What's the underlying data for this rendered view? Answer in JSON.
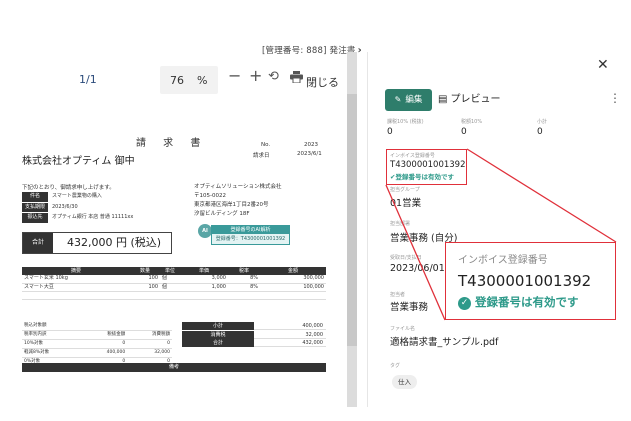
{
  "toolbar": {
    "management_number": "[管理番号: 888] 発注書",
    "page_indicator": "1/1",
    "zoom_value": "76",
    "zoom_unit": "%",
    "close_label": "閉じる"
  },
  "document": {
    "title": "請 求 書",
    "recipient": "株式会社オプティム 御中",
    "no_label": "No.",
    "no_value": "2023",
    "date_label": "請求日",
    "date_value": "2023/6/1",
    "intro": "下記のとおり、御請求申し上げます。",
    "info": [
      {
        "key": "件名",
        "value": "スマート農業物の購入"
      },
      {
        "key": "支払期限",
        "value": "2023/6/30"
      },
      {
        "key": "振込先",
        "value": "オプティム銀行 本店 普通 11111xx"
      }
    ],
    "issuer_lines": [
      "オプティムソリューション株式会社",
      "〒105-0022",
      "東京都港区海岸1丁目2番20号",
      "汐留ビルディング 18F"
    ],
    "total_label": "合計",
    "total_value": "432,000 円 (税込)",
    "ai_badge": "AI",
    "ai_header": "登録番号のAI解析",
    "ai_body": "登録番号：T4300001001392",
    "items_headers": [
      "摘要",
      "数量",
      "単位",
      "単価",
      "税率",
      "金額"
    ],
    "items": [
      [
        "スマート玄米 10kg",
        "100",
        "個",
        "3,000",
        "8%",
        "300,000"
      ],
      [
        "スマート大豆",
        "100",
        "個",
        "1,000",
        "8%",
        "100,000"
      ]
    ],
    "tax_rows": [
      [
        "税込対象額",
        "",
        ""
      ],
      [
        "税率別内訳",
        "税抜金額",
        "消費税額"
      ],
      [
        "10%対象",
        "0",
        "0"
      ],
      [
        "軽減8%対象",
        "400,000",
        "32,000"
      ],
      [
        "0%対象",
        "0",
        "0"
      ]
    ],
    "sums": [
      {
        "key": "小計",
        "value": "400,000"
      },
      {
        "key": "消費税",
        "value": "32,000"
      },
      {
        "key": "合計",
        "value": "432,000"
      }
    ],
    "remarks_label": "備考"
  },
  "panel": {
    "edit_label": "編集",
    "preview_label": "プレビュー",
    "tax_labels": [
      "課税10% (税抜)",
      "税額10%",
      "小計"
    ],
    "tax_values": [
      "0",
      "0",
      "0"
    ],
    "invoice_reg_label": "インボイス登録番号",
    "invoice_reg_value": "T4300001001392",
    "invoice_valid_text": "登録番号は有効です",
    "group_label": "担当グループ",
    "group_value": "01営業",
    "dept_label": "担当部署",
    "dept_value": "営業事務 (自分)",
    "received_label": "受取日/支払日",
    "received_value": "2023/06/01",
    "requester_label": "担当者",
    "requester_value": "営業事務",
    "file_label": "ファイル名",
    "file_value": "適格請求書_サンプル.pdf",
    "tag_label": "タグ",
    "tag_value": "仕入"
  },
  "callout": {
    "label": "インボイス登録番号",
    "value": "T4300001001392",
    "valid_text": "登録番号は有効です"
  },
  "colors": {
    "accent": "#2e7d6b",
    "valid": "#2e9a8a",
    "highlight": "#e0303a"
  }
}
